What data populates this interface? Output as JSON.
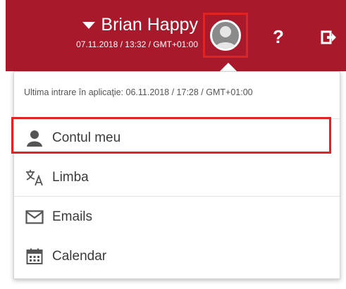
{
  "header": {
    "user_name": "Brian Happy",
    "user_datetime": "07.11.2018 / 13:32 / GMT+01:00",
    "help_label": "?"
  },
  "dropdown": {
    "last_login": "Ultima intrare în aplicaţie: 06.11.2018 / 17:28 / GMT+01:00",
    "items": [
      {
        "label": "Contul meu",
        "icon": "user-icon"
      },
      {
        "label": "Limba",
        "icon": "translate-icon"
      },
      {
        "label": "Emails",
        "icon": "envelope-icon"
      },
      {
        "label": "Calendar",
        "icon": "calendar-icon"
      }
    ]
  },
  "colors": {
    "header_bg": "#a8192b",
    "highlight": "#e02424"
  }
}
